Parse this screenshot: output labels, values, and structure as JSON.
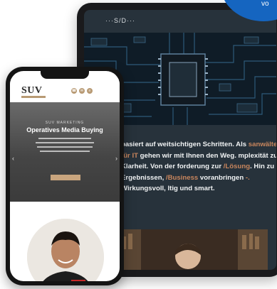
{
  "badge": {
    "text": "vo"
  },
  "tablet": {
    "logo": "···S/D···",
    "text_parts": [
      {
        "text": " basiert auf weitsichtigen Schritten. Als ",
        "hl": false
      },
      {
        "text": "sanwälte für IT",
        "hl": true
      },
      {
        "text": " gehen wir mit Ihnen den Weg. ",
        "hl": false
      },
      {
        "text": "mplexität zur Klarheit. Von der ",
        "hl": false
      },
      {
        "text": "forderung zur ",
        "hl": false
      },
      {
        "text": "/Lösung",
        "hl": true
      },
      {
        "text": ". Hin zu Ergebnissen, ",
        "hl": false
      },
      {
        "text": "/Business",
        "hl": true
      },
      {
        "text": " voranbringen ",
        "hl": false
      },
      {
        "text": "-.",
        "hl": true
      },
      {
        "text": " Wirkungsvoll, ",
        "hl": false
      },
      {
        "text": "ltig und smart.",
        "hl": false
      }
    ]
  },
  "phone": {
    "logo": "SUV",
    "hero_kicker": "SUV MARKETING",
    "hero_title": "Operatives Media Buying"
  },
  "colors": {
    "accent": "#c9865d",
    "badge": "#1565c0",
    "phone_gold": "#b89a74",
    "tablet_bg": "#27323b"
  }
}
